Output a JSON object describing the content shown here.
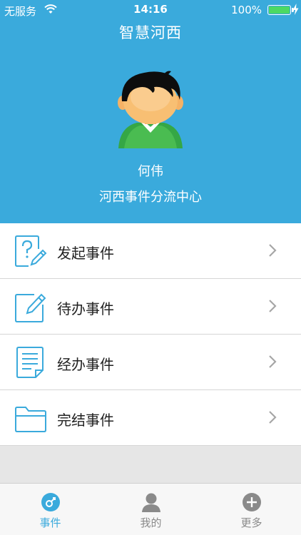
{
  "status_bar": {
    "carrier": "无服务",
    "time": "14:16",
    "battery": "100%",
    "battery_level": 1.0
  },
  "header": {
    "title": "智慧河西",
    "user_name": "何伟",
    "organization": "河西事件分流中心"
  },
  "menu": {
    "items": [
      {
        "label": "发起事件",
        "icon": "question-edit-icon"
      },
      {
        "label": "待办事件",
        "icon": "edit-box-icon"
      },
      {
        "label": "经办事件",
        "icon": "document-icon"
      },
      {
        "label": "完结事件",
        "icon": "folder-icon"
      }
    ]
  },
  "tabbar": {
    "tabs": [
      {
        "label": "事件",
        "icon": "event-icon",
        "active": true
      },
      {
        "label": "我的",
        "icon": "person-icon",
        "active": false
      },
      {
        "label": "更多",
        "icon": "plus-circle-icon",
        "active": false
      }
    ]
  },
  "colors": {
    "primary": "#3aaadc",
    "background": "#e6e6e6",
    "tab_inactive": "#8a8a8a"
  }
}
